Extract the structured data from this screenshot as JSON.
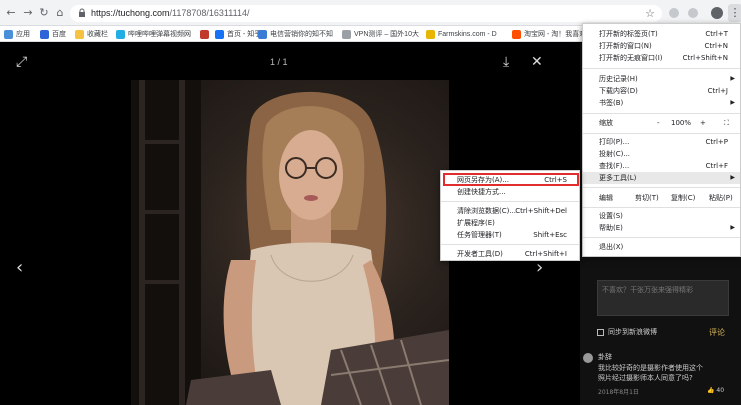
{
  "browser": {
    "url_host": "https://tuchong.com",
    "url_path": "/1178708/16311114/",
    "bookmarks": [
      {
        "label": "应用",
        "color": "#4a90d9"
      },
      {
        "label": "百度",
        "color": "#2e64d8"
      },
      {
        "label": "收藏栏",
        "color": "#f5c242"
      },
      {
        "label": "哔哩哔哩弹幕视频网",
        "color": "#23ade5"
      },
      {
        "label": "",
        "color": "#c0392b"
      },
      {
        "label": "首页 - 知乎",
        "color": "#1772f6"
      },
      {
        "label": "电信营销你的知不知",
        "color": "#3a7bd5"
      },
      {
        "label": "VPN测评 – 国外10大",
        "color": "#9aa0a6"
      },
      {
        "label": "Farmskins.com - D",
        "color": "#e8b500"
      },
      {
        "label": "淘宝网 - 淘！我喜欢",
        "color": "#ff5000"
      },
      {
        "label": "",
        "color": "#e74c3c"
      }
    ]
  },
  "viewer": {
    "counter": "1 / 1"
  },
  "side": {
    "comment_placeholder": "不喜欢？干张万张来强得精彩",
    "sync_label": "同步到新浪微博",
    "submit_label": "评论",
    "comment_user": "卦辞",
    "comment_text": "我比较好奇的是摄影作者使用这个照片经过摄影师本人同意了吗?",
    "comment_date": "2018年8月1日",
    "comment_likes": "40"
  },
  "main_menu": {
    "new_tab": {
      "label": "打开新的标签页(T)",
      "shortcut": "Ctrl+T"
    },
    "new_window": {
      "label": "打开新的窗口(N)",
      "shortcut": "Ctrl+N"
    },
    "incognito": {
      "label": "打开新的无痕窗口(I)",
      "shortcut": "Ctrl+Shift+N"
    },
    "history": {
      "label": "历史记录(H)"
    },
    "downloads": {
      "label": "下载内容(D)",
      "shortcut": "Ctrl+J"
    },
    "bookmarks": {
      "label": "书签(B)"
    },
    "zoom": {
      "label": "缩放",
      "minus": "-",
      "value": "100%",
      "plus": "+"
    },
    "print": {
      "label": "打印(P)...",
      "shortcut": "Ctrl+P"
    },
    "cast": {
      "label": "投射(C)..."
    },
    "find": {
      "label": "查找(F)...",
      "shortcut": "Ctrl+F"
    },
    "more_tools": {
      "label": "更多工具(L)"
    },
    "edit": {
      "label": "编辑",
      "cut": "剪切(T)",
      "copy": "复制(C)",
      "paste": "粘贴(P)"
    },
    "settings": {
      "label": "设置(S)"
    },
    "help": {
      "label": "帮助(E)"
    },
    "exit": {
      "label": "退出(X)"
    }
  },
  "sub_menu": {
    "save_page": {
      "label": "网页另存为(A)...",
      "shortcut": "Ctrl+S"
    },
    "create_shortcut": {
      "label": "创建快捷方式..."
    },
    "clear_data": {
      "label": "清除浏览数据(C)...",
      "shortcut": "Ctrl+Shift+Del"
    },
    "extensions": {
      "label": "扩展程序(E)"
    },
    "task_manager": {
      "label": "任务管理器(T)",
      "shortcut": "Shift+Esc"
    },
    "devtools": {
      "label": "开发者工具(D)",
      "shortcut": "Ctrl+Shift+I"
    }
  },
  "colors": {
    "highlight_box": "#e02d2d",
    "submit": "#d7b35a"
  }
}
